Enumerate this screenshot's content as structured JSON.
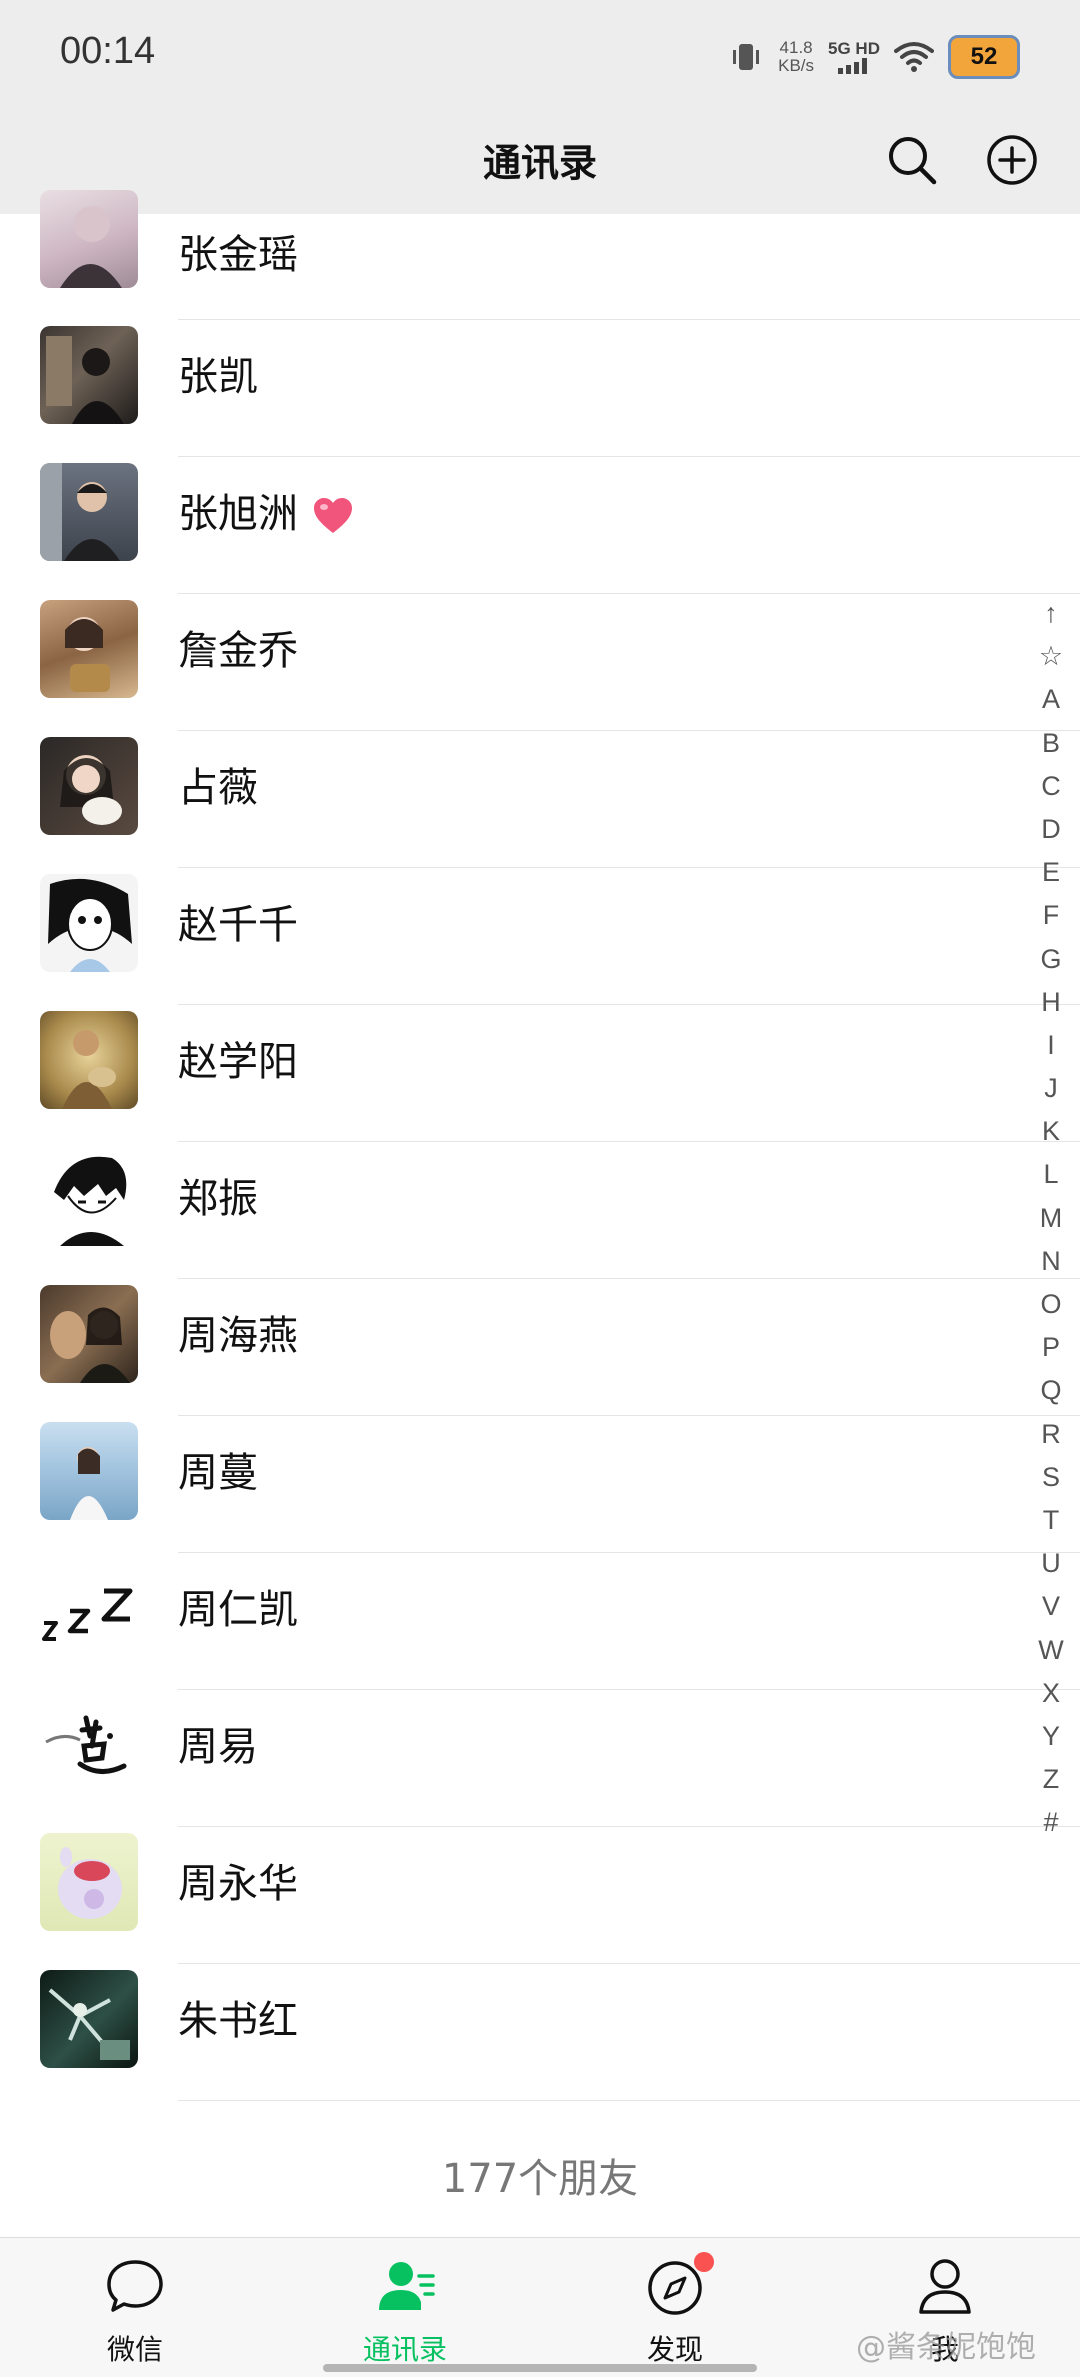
{
  "status_bar": {
    "time": "00:14",
    "net_speed_value": "41.8",
    "net_speed_unit": "KB/s",
    "network_type": "5G HD",
    "battery": "52"
  },
  "header": {
    "title": "通讯录",
    "search_icon": "search-icon",
    "add_icon": "plus-circle-icon"
  },
  "contacts": [
    {
      "name": "张金瑶"
    },
    {
      "name": "张凯"
    },
    {
      "name": "张旭洲"
    },
    {
      "name": "詹金乔"
    },
    {
      "name": "占薇"
    },
    {
      "name": "赵千千"
    },
    {
      "name": "赵学阳"
    },
    {
      "name": "郑振"
    },
    {
      "name": "周海燕"
    },
    {
      "name": "周蔓"
    },
    {
      "name": "周仁凯"
    },
    {
      "name": "周易"
    },
    {
      "name": "周永华"
    },
    {
      "name": "朱书红"
    }
  ],
  "friend_count": "177个朋友",
  "index_bar": [
    "↑",
    "☆",
    "A",
    "B",
    "C",
    "D",
    "E",
    "F",
    "G",
    "H",
    "I",
    "J",
    "K",
    "L",
    "M",
    "N",
    "O",
    "P",
    "Q",
    "R",
    "S",
    "T",
    "U",
    "V",
    "W",
    "X",
    "Y",
    "Z",
    "#"
  ],
  "tabbar": {
    "tabs": [
      {
        "label": "微信",
        "icon": "chat-bubble-icon"
      },
      {
        "label": "通讯录",
        "icon": "contacts-icon"
      },
      {
        "label": "发现",
        "icon": "compass-icon"
      },
      {
        "label": "我",
        "icon": "person-icon"
      }
    ]
  },
  "watermark": "@酱条妮饱饱",
  "colors": {
    "accent": "#07c160",
    "header_bg": "#ededed",
    "badge": "#fa5151"
  }
}
